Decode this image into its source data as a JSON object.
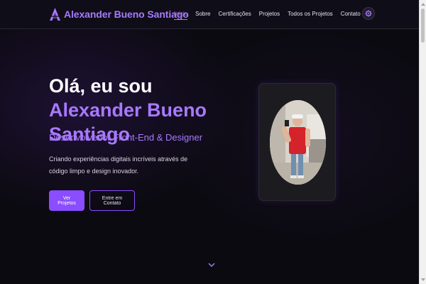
{
  "header": {
    "brand_name": "Alexander Bueno Santiago",
    "brand_logo_icon": "triangle-a-logo-icon",
    "nav": [
      {
        "label": "Início",
        "active": true
      },
      {
        "label": "Sobre",
        "active": false
      },
      {
        "label": "Certificações",
        "active": false
      },
      {
        "label": "Projetos",
        "active": false
      },
      {
        "label": "Todos os Projetos",
        "active": false
      },
      {
        "label": "Contato",
        "active": false
      }
    ],
    "theme_toggle_icon": "gear-icon"
  },
  "hero": {
    "title_prefix": "Olá, eu sou ",
    "title_name": "Alexander Bueno Santiago",
    "subtitle": "Desenvolvedor Front-End & Designer",
    "description": "Criando experiências digitais incríveis através de código limpo e design inovador.",
    "primary_button": "Ver Projetos",
    "secondary_button": "Entre em Contato",
    "profile_photo": "profile-photo",
    "scroll_icon": "chevron-down-icon"
  },
  "colors": {
    "accent": "#a879ff",
    "button": "#8a4dff",
    "background": "#0b0a10",
    "card": "#1c1c20"
  }
}
